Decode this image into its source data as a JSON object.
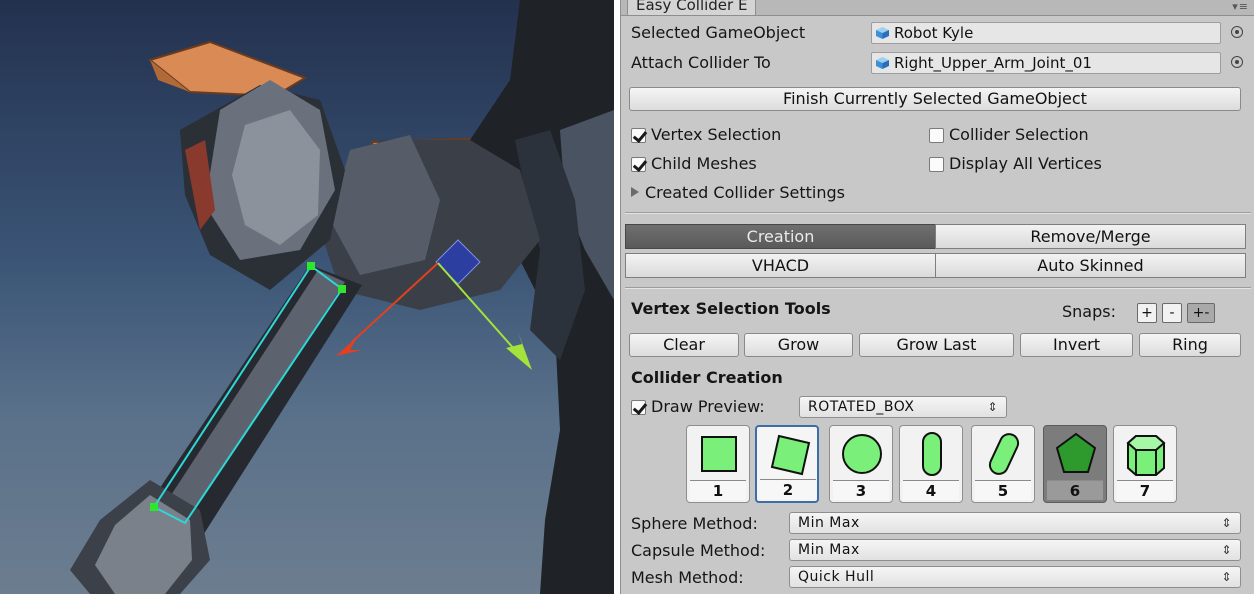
{
  "scene": {
    "name": "scene-view"
  },
  "inspector": {
    "title": "Easy Collider E",
    "selected_gameobject": {
      "label": "Selected GameObject",
      "value": "Robot Kyle"
    },
    "attach_collider_to": {
      "label": "Attach Collider To",
      "value": "Right_Upper_Arm_Joint_01"
    },
    "finish_button": "Finish Currently Selected GameObject",
    "checkboxes": {
      "vertex_selection": {
        "label": "Vertex Selection",
        "checked": true
      },
      "collider_selection": {
        "label": "Collider Selection",
        "checked": false
      },
      "child_meshes": {
        "label": "Child Meshes",
        "checked": true
      },
      "display_all_vertices": {
        "label": "Display All Vertices",
        "checked": false
      }
    },
    "foldout": "Created Collider Settings",
    "tabs": {
      "creation": "Creation",
      "remove_merge": "Remove/Merge",
      "vhacd": "VHACD",
      "auto_skinned": "Auto Skinned"
    },
    "vertex_tools": {
      "heading": "Vertex Selection Tools",
      "snaps_label": "Snaps:",
      "snaps": [
        "+",
        "-",
        "+-"
      ],
      "buttons": [
        "Clear",
        "Grow",
        "Grow Last",
        "Invert",
        "Ring"
      ]
    },
    "collider_creation": {
      "heading": "Collider Creation",
      "draw_preview": {
        "label": "Draw Preview:",
        "checked": true,
        "value": "ROTATED_BOX"
      },
      "tiles": [
        "1",
        "2",
        "3",
        "4",
        "5",
        "6",
        "7"
      ],
      "selected_tile": "2"
    },
    "methods": {
      "sphere": {
        "label": "Sphere Method:",
        "value": "Min Max"
      },
      "capsule": {
        "label": "Capsule Method:",
        "value": "Min Max"
      },
      "mesh": {
        "label": "Mesh Method:",
        "value": "Quick Hull"
      }
    }
  },
  "colors": {
    "accent_blue": "#3b6ea8",
    "shape_green": "#7aef7a",
    "selection_cyan": "#2fd6d6"
  }
}
